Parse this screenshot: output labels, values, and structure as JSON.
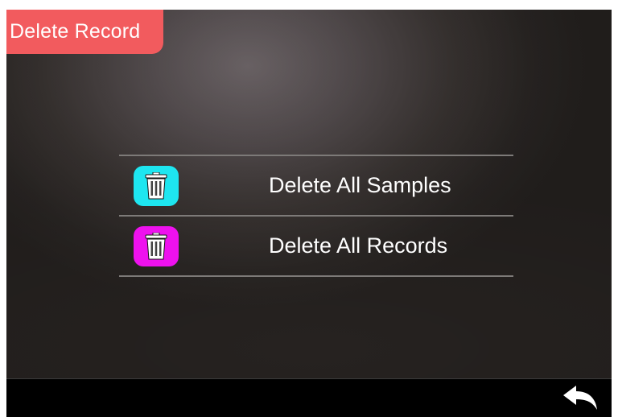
{
  "header": {
    "title": "Delete Record"
  },
  "menu": {
    "items": [
      {
        "label": "Delete All Samples",
        "icon": "trash-icon",
        "color": "#1ee6f0"
      },
      {
        "label": "Delete All Records",
        "icon": "trash-icon",
        "color": "#ee11ee"
      }
    ]
  },
  "footer": {
    "back_icon": "back-arrow-icon"
  },
  "colors": {
    "title_tab": "#f25b5e",
    "background": "#3e3836",
    "bottom_bar": "#000000"
  }
}
